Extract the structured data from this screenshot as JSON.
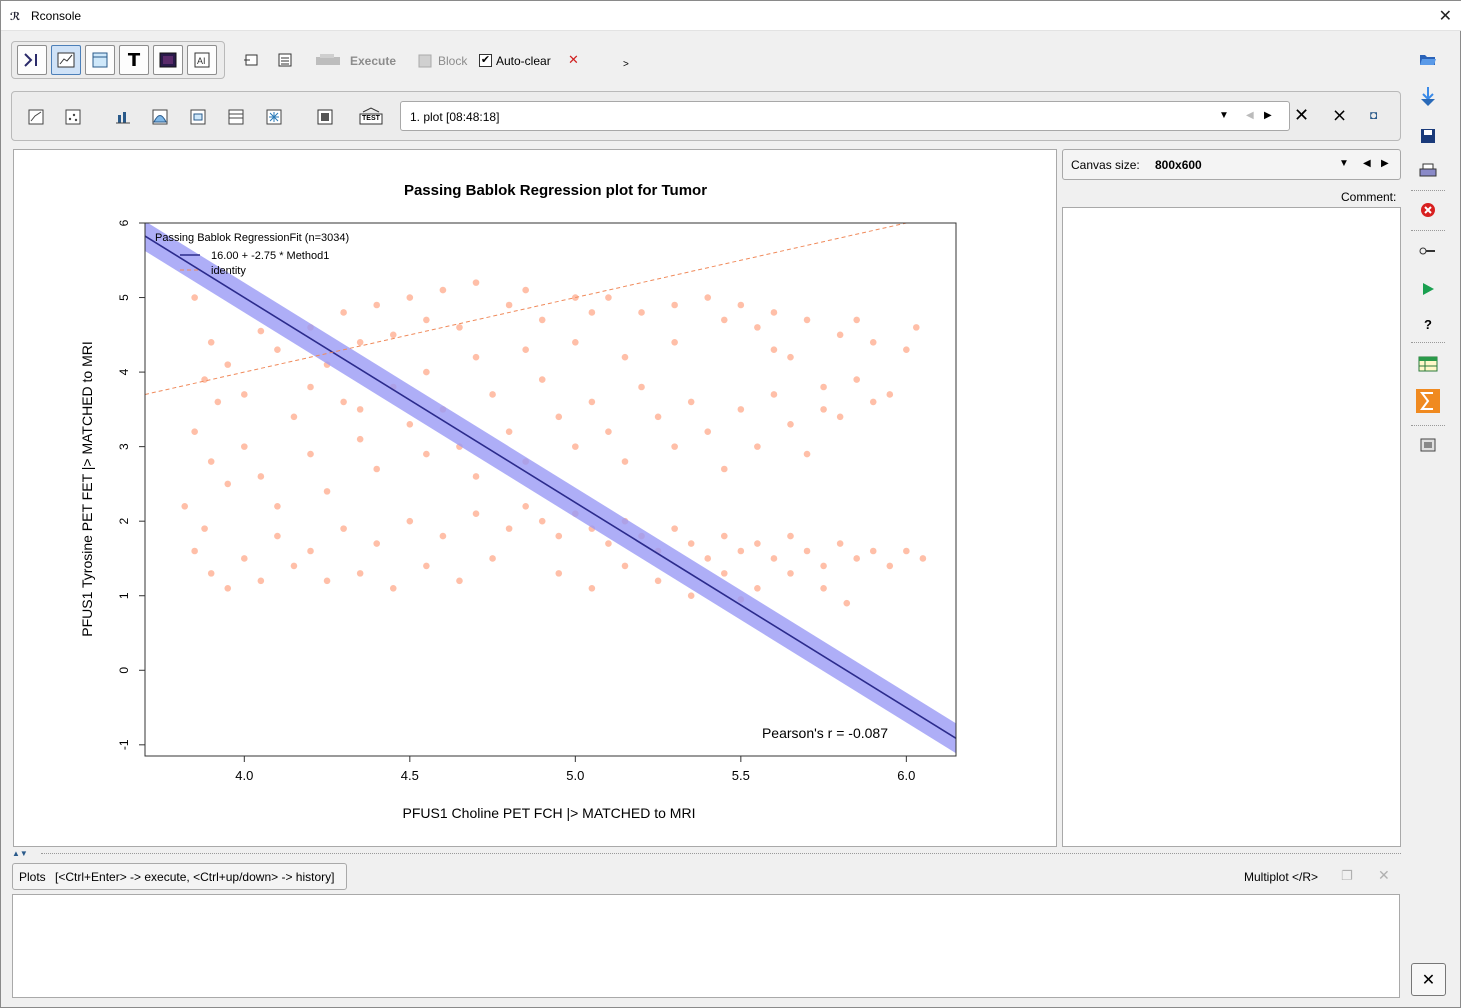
{
  "window": {
    "title": "Rconsole",
    "app_icon": "rconsole-app-icon"
  },
  "toolbar": {
    "execute_label": "Execute",
    "block_label": "Block",
    "autoclear_label": "Auto-clear",
    "autoclear_checked": true,
    "more": ">"
  },
  "plot_toolbar": {
    "plot_select": "1. plot [08:48:18]",
    "test_label": "TEST"
  },
  "canvas": {
    "label": "Canvas size:",
    "value": "800x600"
  },
  "comment": {
    "label": "Comment:"
  },
  "console": {
    "tab_plots": "Plots",
    "hint": "[<Ctrl+Enter> -> execute, <Ctrl+up/down> -> history]",
    "multiplot": "Multiplot </R>"
  },
  "chart_data": {
    "type": "scatter",
    "title": "Passing Bablok Regression plot for Tumor",
    "xlabel": "PFUS1 Choline PET FCH |> MATCHED to MRI",
    "ylabel": "PFUS1 Tyrosine PET FET |> MATCHED to MRI",
    "xlim": [
      3.7,
      6.15
    ],
    "ylim": [
      -1.15,
      6.0
    ],
    "x_ticks": [
      "4.0",
      "4.5",
      "5.0",
      "5.5",
      "6.0"
    ],
    "y_ticks": [
      "-1",
      "0",
      "1",
      "2",
      "3",
      "4",
      "5",
      "6"
    ],
    "legend": {
      "position": "top-left",
      "title": "Passing Bablok RegressionFit (n=3034)",
      "entries": [
        "16.00 + -2.75 * Method1",
        "identity"
      ]
    },
    "annotation": "Pearson's r = -0.087",
    "n": 3034,
    "fit": {
      "intercept": 16.0,
      "slope": -2.75,
      "ci_halfwidth": 0.2,
      "color": "#2b2b8c",
      "band_color": "#9a9af5"
    },
    "identity": {
      "color": "#f08a5b"
    },
    "points_color": "#ff8a60",
    "points": [
      [
        3.85,
        5.0
      ],
      [
        3.9,
        4.4
      ],
      [
        3.95,
        4.1
      ],
      [
        3.88,
        3.9
      ],
      [
        3.92,
        3.6
      ],
      [
        4.05,
        4.55
      ],
      [
        4.1,
        4.3
      ],
      [
        4.2,
        4.6
      ],
      [
        4.25,
        4.1
      ],
      [
        4.3,
        4.8
      ],
      [
        4.35,
        4.4
      ],
      [
        4.4,
        4.9
      ],
      [
        4.45,
        4.5
      ],
      [
        4.5,
        5.0
      ],
      [
        4.55,
        4.7
      ],
      [
        4.6,
        5.1
      ],
      [
        4.65,
        4.6
      ],
      [
        4.7,
        5.2
      ],
      [
        4.8,
        4.9
      ],
      [
        4.85,
        5.1
      ],
      [
        4.9,
        4.7
      ],
      [
        5.0,
        5.0
      ],
      [
        5.05,
        4.8
      ],
      [
        5.1,
        5.0
      ],
      [
        5.2,
        4.8
      ],
      [
        5.3,
        4.9
      ],
      [
        5.4,
        5.0
      ],
      [
        5.45,
        4.7
      ],
      [
        5.5,
        4.9
      ],
      [
        5.55,
        4.6
      ],
      [
        5.6,
        4.8
      ],
      [
        5.7,
        4.7
      ],
      [
        5.8,
        4.5
      ],
      [
        5.85,
        4.7
      ],
      [
        5.9,
        4.4
      ],
      [
        6.0,
        4.3
      ],
      [
        6.03,
        4.6
      ],
      [
        5.95,
        3.7
      ],
      [
        5.75,
        3.5
      ],
      [
        5.65,
        4.2
      ],
      [
        3.85,
        3.2
      ],
      [
        3.9,
        2.8
      ],
      [
        3.95,
        2.5
      ],
      [
        3.82,
        2.2
      ],
      [
        3.88,
        1.9
      ],
      [
        4.0,
        3.0
      ],
      [
        4.05,
        2.6
      ],
      [
        4.1,
        2.2
      ],
      [
        4.15,
        3.4
      ],
      [
        4.2,
        2.9
      ],
      [
        4.25,
        2.4
      ],
      [
        4.3,
        3.6
      ],
      [
        4.35,
        3.1
      ],
      [
        4.4,
        2.7
      ],
      [
        4.45,
        3.8
      ],
      [
        4.5,
        3.3
      ],
      [
        4.55,
        2.9
      ],
      [
        4.6,
        3.5
      ],
      [
        4.65,
        3.0
      ],
      [
        4.7,
        2.6
      ],
      [
        4.75,
        3.7
      ],
      [
        4.8,
        3.2
      ],
      [
        4.85,
        2.8
      ],
      [
        4.9,
        3.9
      ],
      [
        4.95,
        3.4
      ],
      [
        5.0,
        3.0
      ],
      [
        5.05,
        3.6
      ],
      [
        5.1,
        3.2
      ],
      [
        5.15,
        2.8
      ],
      [
        5.2,
        3.8
      ],
      [
        5.25,
        3.4
      ],
      [
        5.3,
        3.0
      ],
      [
        5.35,
        3.6
      ],
      [
        5.4,
        3.2
      ],
      [
        5.45,
        2.7
      ],
      [
        5.5,
        3.5
      ],
      [
        5.55,
        3.0
      ],
      [
        5.6,
        3.7
      ],
      [
        5.65,
        3.3
      ],
      [
        5.7,
        2.9
      ],
      [
        5.75,
        3.8
      ],
      [
        5.8,
        3.4
      ],
      [
        5.85,
        3.9
      ],
      [
        5.9,
        3.6
      ],
      [
        4.1,
        1.8
      ],
      [
        4.2,
        1.6
      ],
      [
        4.3,
        1.9
      ],
      [
        4.4,
        1.7
      ],
      [
        4.5,
        2.0
      ],
      [
        4.6,
        1.8
      ],
      [
        4.7,
        2.1
      ],
      [
        4.8,
        1.9
      ],
      [
        4.85,
        2.2
      ],
      [
        4.9,
        2.0
      ],
      [
        4.95,
        1.8
      ],
      [
        5.0,
        2.1
      ],
      [
        5.05,
        1.9
      ],
      [
        5.1,
        1.7
      ],
      [
        5.15,
        2.0
      ],
      [
        5.2,
        1.8
      ],
      [
        5.25,
        1.6
      ],
      [
        5.3,
        1.9
      ],
      [
        5.35,
        1.7
      ],
      [
        5.4,
        1.5
      ],
      [
        5.45,
        1.8
      ],
      [
        5.5,
        1.6
      ],
      [
        5.55,
        1.7
      ],
      [
        5.6,
        1.5
      ],
      [
        5.65,
        1.8
      ],
      [
        5.7,
        1.6
      ],
      [
        5.75,
        1.4
      ],
      [
        5.8,
        1.7
      ],
      [
        5.85,
        1.5
      ],
      [
        5.9,
        1.6
      ],
      [
        5.95,
        1.4
      ],
      [
        6.0,
        1.6
      ],
      [
        6.05,
        1.5
      ],
      [
        3.85,
        1.6
      ],
      [
        3.9,
        1.3
      ],
      [
        3.95,
        1.1
      ],
      [
        4.0,
        1.5
      ],
      [
        4.05,
        1.2
      ],
      [
        4.15,
        1.4
      ],
      [
        4.25,
        1.2
      ],
      [
        4.35,
        1.3
      ],
      [
        4.45,
        1.1
      ],
      [
        4.55,
        1.4
      ],
      [
        4.65,
        1.2
      ],
      [
        4.75,
        1.5
      ],
      [
        4.95,
        1.3
      ],
      [
        5.05,
        1.1
      ],
      [
        5.15,
        1.4
      ],
      [
        5.25,
        1.2
      ],
      [
        5.35,
        1.0
      ],
      [
        5.45,
        1.3
      ],
      [
        5.55,
        1.1
      ],
      [
        5.65,
        1.3
      ],
      [
        5.75,
        1.1
      ],
      [
        5.82,
        0.9
      ],
      [
        5.5,
        0.95
      ],
      [
        4.7,
        4.2
      ],
      [
        4.55,
        4.0
      ],
      [
        4.35,
        3.5
      ],
      [
        4.2,
        3.8
      ],
      [
        4.0,
        3.7
      ],
      [
        5.3,
        4.4
      ],
      [
        5.15,
        4.2
      ],
      [
        5.0,
        4.4
      ],
      [
        4.85,
        4.3
      ],
      [
        5.6,
        4.3
      ]
    ]
  }
}
